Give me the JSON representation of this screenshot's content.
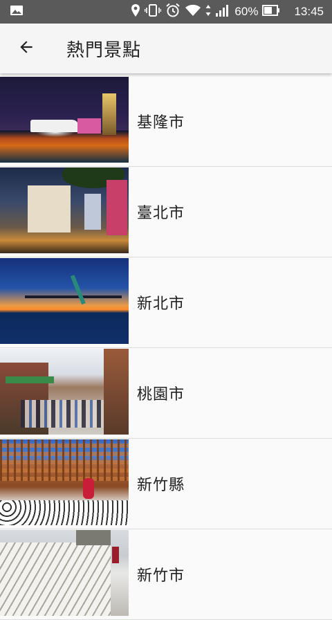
{
  "status_bar": {
    "battery_percent": "60%",
    "time": "13:45",
    "icons": [
      "image-notification-icon",
      "location-icon",
      "vibrate-icon",
      "alarm-icon",
      "wifi-icon",
      "data-arrows-icon",
      "signal-icon",
      "battery-icon"
    ]
  },
  "appbar": {
    "title": "熱門景點",
    "back_icon": "arrow-left-icon"
  },
  "items": [
    {
      "label": "基隆市"
    },
    {
      "label": "臺北市"
    },
    {
      "label": "新北市"
    },
    {
      "label": "桃園市"
    },
    {
      "label": "新竹縣"
    },
    {
      "label": "新竹市"
    }
  ]
}
